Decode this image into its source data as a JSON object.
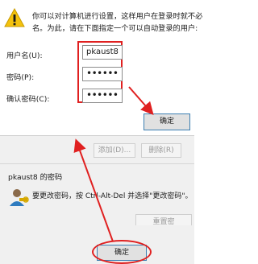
{
  "dialog": {
    "desc_line1": "你可以对计算机进行设置，这样用户在登录时就不必",
    "desc_line2": "名。为此，请在下面指定一个可以自动登录的用户:",
    "username_label": "用户名(U):",
    "username_value": "pkaust8",
    "password_label": "密码(P):",
    "password_value": "••••••",
    "confirm_label": "确认密码(C):",
    "confirm_value": "••••••",
    "ok_label": "确定"
  },
  "users_panel": {
    "add_label": "添加(D)...",
    "delete_label": "删除(R)",
    "group_title": "pkaust8 的密码",
    "change_pwd_text": "要更改密码，按 Ctrl-Alt-Del 并选择\"更改密码\"。",
    "reset_label": "重置密",
    "ok_label": "确定"
  },
  "colors": {
    "annotation": "#e02020",
    "accent": "#3c7fb1"
  },
  "icons": [
    "warning-icon",
    "user-key-icon"
  ]
}
